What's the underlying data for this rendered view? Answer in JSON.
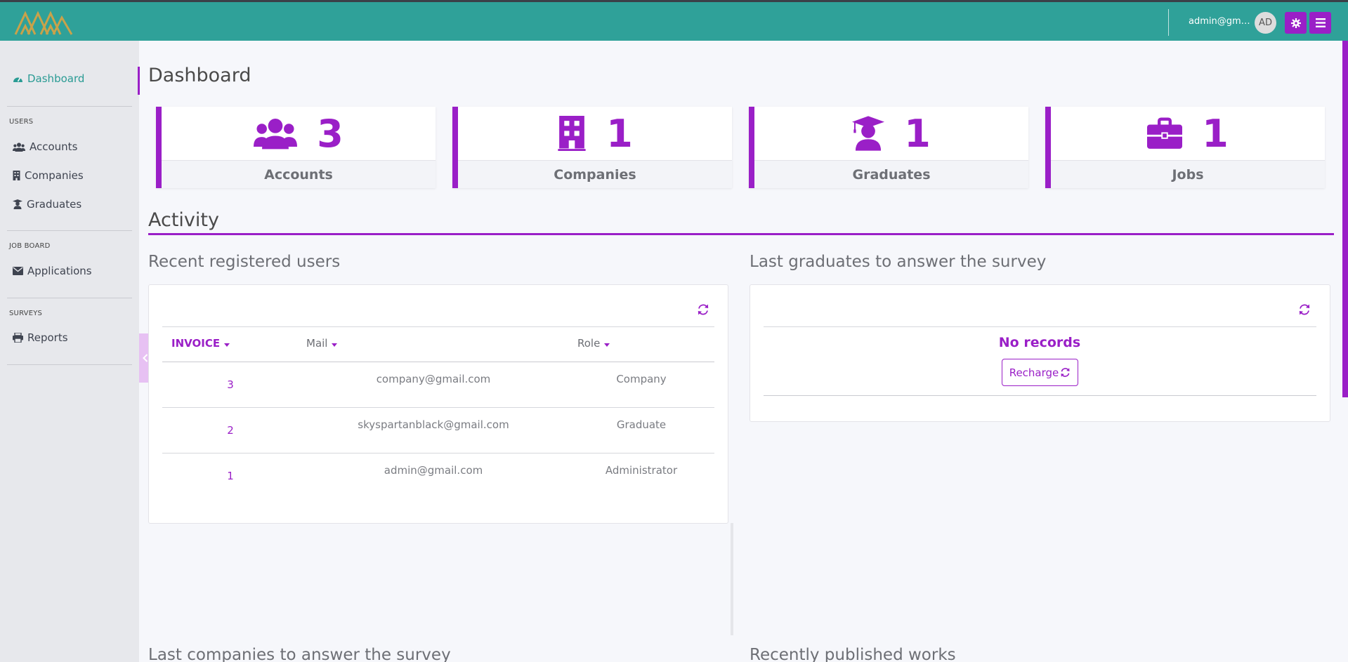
{
  "header": {
    "user_email": "admin@gmai...",
    "avatar_initials": "AD",
    "brand_color": "#2fa199",
    "accent_color": "#9a1fc7"
  },
  "sidebar": {
    "dashboard": {
      "label": "Dashboard",
      "icon": "tachometer-icon"
    },
    "categories": {
      "users": "USERS",
      "job_board": "JOB BOARD",
      "surveys": "SURVEYS"
    },
    "items": [
      {
        "label": "Accounts",
        "icon": "users-icon"
      },
      {
        "label": "Companies",
        "icon": "building-icon"
      },
      {
        "label": "Graduates",
        "icon": "graduate-icon"
      },
      {
        "label": "Applications",
        "icon": "envelope-icon"
      },
      {
        "label": "Reports",
        "icon": "print-icon"
      }
    ]
  },
  "main": {
    "title": "Dashboard",
    "stats": [
      {
        "count": "3",
        "label": "Accounts",
        "icon": "users-icon"
      },
      {
        "count": "1",
        "label": "Companies",
        "icon": "building-icon"
      },
      {
        "count": "1",
        "label": "Graduates",
        "icon": "graduate-icon"
      },
      {
        "count": "1",
        "label": "Jobs",
        "icon": "briefcase-icon"
      }
    ],
    "activity_title": "Activity",
    "recent_users": {
      "title": "Recent registered users",
      "columns": [
        "INVOICE",
        "Mail",
        "Role"
      ],
      "rows": [
        {
          "id": "3",
          "mail": "company@gmail.com",
          "role": "Company"
        },
        {
          "id": "2",
          "mail": "skyspartanblack@gmail.com",
          "role": "Graduate"
        },
        {
          "id": "1",
          "mail": "admin@gmail.com",
          "role": "Administrator"
        }
      ]
    },
    "last_graduates": {
      "title": "Last graduates to answer the survey",
      "empty_text": "No records",
      "recharge_label": "Recharge"
    },
    "last_companies_title": "Last companies to answer the survey",
    "recent_works_title": "Recently published works"
  }
}
